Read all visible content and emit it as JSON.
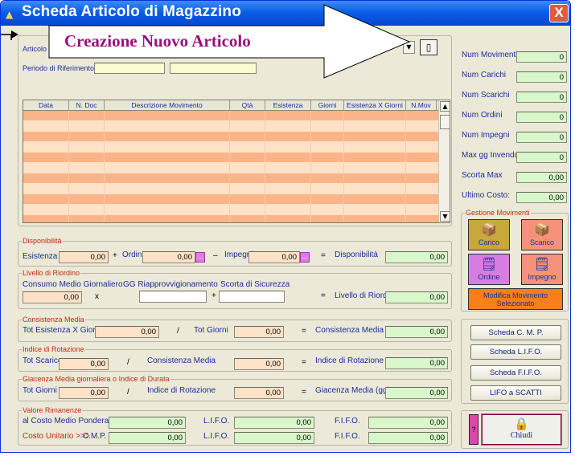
{
  "window": {
    "title": "Scheda Articolo di Magazzino",
    "close": "X"
  },
  "callout": {
    "text": "Creazione Nuovo Articolo"
  },
  "top": {
    "articolo_label": "Articolo",
    "periodo_label": "Periodo di Riferimento"
  },
  "grid": {
    "columns": [
      "Data",
      "N. Doc",
      "Descrizione Movimento",
      "Qtà",
      "Esistenza",
      "Giorni",
      "Esistenza X Giorni",
      "N.Mov"
    ],
    "row_count": 12
  },
  "stats": {
    "items": [
      {
        "label": "Num Movimenti",
        "value": "0"
      },
      {
        "label": "Num Carichi",
        "value": "0"
      },
      {
        "label": "Num Scarichi",
        "value": "0"
      },
      {
        "label": "Num Ordini",
        "value": "0"
      },
      {
        "label": "Num Impegni",
        "value": "0"
      },
      {
        "label": "Max gg Invenduto",
        "value": "0"
      },
      {
        "label": "Scorta Max",
        "value": "0,00"
      },
      {
        "label": "Ultimo Costo:",
        "value": "0,00"
      }
    ]
  },
  "gestione": {
    "legend": "Gestione Movimenti",
    "carico": "Carico",
    "scarico": "Scarico",
    "ordine": "Ordine",
    "impegno": "Impegno",
    "modifica": "Modifica Movimento Selezionato"
  },
  "disponibilita": {
    "legend": "Disponibilità",
    "esistenza_label": "Esistenza",
    "esistenza": "0,00",
    "ordini_label": "Ordini",
    "ordini": "0,00",
    "impegni_label": "Impegni",
    "impegni": "0,00",
    "result_label": "Disponibilità",
    "result": "0,00",
    "plus": "+",
    "minus": "–",
    "eq": "="
  },
  "riordino": {
    "legend": "Livello di Riordino",
    "consumo_label": "Consumo Medio Giornaliero",
    "consumo": "0,00",
    "gg_label": "GG Riapprovvigionamento",
    "gg": "",
    "scorta_label": "Scorta di Sicurezza",
    "scorta": "",
    "result_label": "Livello di Riordino",
    "result": "0,00",
    "x": "x",
    "plus": "+",
    "eq": "="
  },
  "consistenza": {
    "legend": "Consistenza Media",
    "a_label": "Tot Esistenza X Giorni",
    "a": "0,00",
    "b_label": "Tot Giorni",
    "b": "0,00",
    "result_label": "Consistenza Media",
    "result": "0,00",
    "div": "/",
    "eq": "="
  },
  "rotazione": {
    "legend": "Indice di Rotazione",
    "a_label": "Tot Scarico",
    "a": "0,00",
    "b_label": "Consistenza Media",
    "b": "0,00",
    "result_label": "Indice di Rotazione",
    "result": "0,00",
    "div": "/",
    "eq": "="
  },
  "giacenza": {
    "legend": "Giacenza Media giornaliera o Indice di Durata",
    "a_label": "Tot Giorni",
    "a": "0,00",
    "b_label": "Indice di Rotazione",
    "b": "0,00",
    "result_label": "Giacenza Media (gg)",
    "result": "0,00",
    "div": "/",
    "eq": "="
  },
  "rimanenze": {
    "legend": "Valore Rimanenze",
    "row1_label": "al Costo Medio Ponderato",
    "row1_v": "0,00",
    "lifo1_label": "L.I.F.O.",
    "lifo1": "0,00",
    "fifo1_label": "F.I.F.O.",
    "fifo1": "0,00",
    "row2_label": "Costo Unitario >>>",
    "cmp_label": "C.M.P.",
    "row2_v": "0,00",
    "lifo2_label": "L.I.F.O.",
    "lifo2": "0,00",
    "fifo2_label": "F.I.F.O.",
    "fifo2": "0,00"
  },
  "side_buttons": [
    "Scheda C. M. P.",
    "Scheda L.I.F.O.",
    "Scheda F.I.F.O.",
    "LIFO a SCATTI"
  ],
  "help": "?",
  "chiudi": "Chiudi"
}
